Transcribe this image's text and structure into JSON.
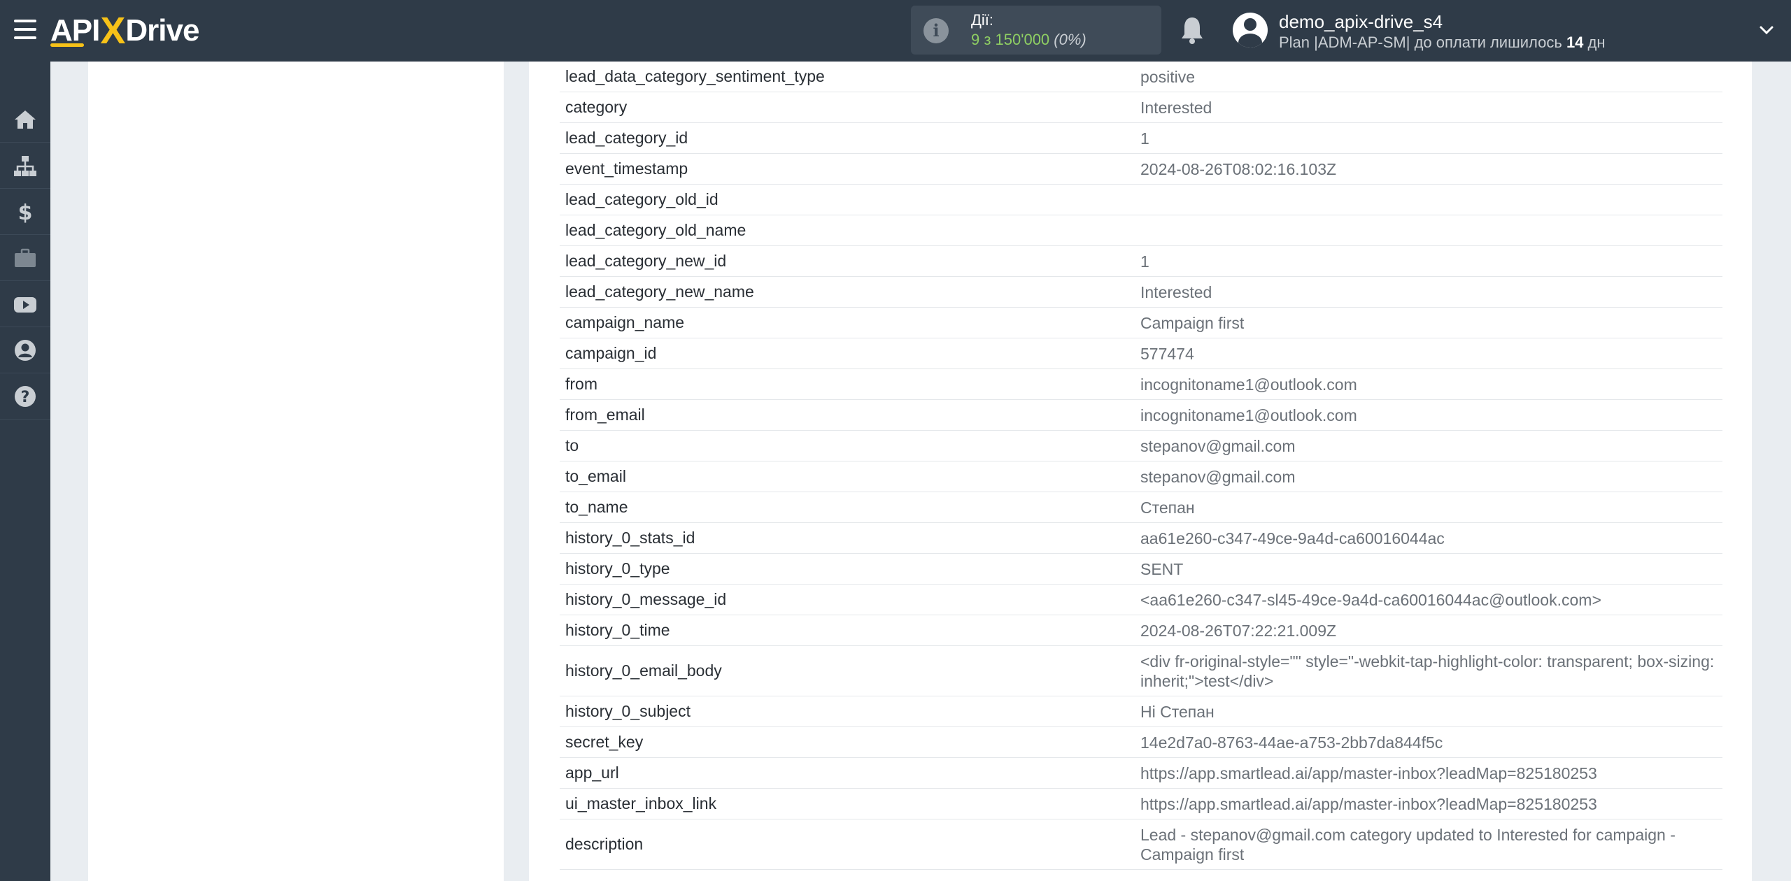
{
  "header": {
    "logo_left": "API",
    "logo_x": "X",
    "logo_right": "Drive",
    "actions_label": "Дії:",
    "actions_count": "9 з 150'000",
    "actions_pct": "(0%)",
    "user_name": "demo_apix-drive_s4",
    "plan_prefix": "Plan |ADM-AP-SM| до оплати лишилось ",
    "plan_days": "14",
    "plan_suffix": " дн"
  },
  "sidebar": {
    "items": [
      "home-icon",
      "sitemap-icon",
      "dollar-icon",
      "briefcase-icon",
      "youtube-icon",
      "user-circle-icon",
      "help-icon"
    ]
  },
  "table": {
    "rows": [
      {
        "key": "lead_data_category_sentiment_type",
        "value": "positive"
      },
      {
        "key": "category",
        "value": "Interested"
      },
      {
        "key": "lead_category_id",
        "value": "1"
      },
      {
        "key": "event_timestamp",
        "value": "2024-08-26T08:02:16.103Z"
      },
      {
        "key": "lead_category_old_id",
        "value": ""
      },
      {
        "key": "lead_category_old_name",
        "value": ""
      },
      {
        "key": "lead_category_new_id",
        "value": "1"
      },
      {
        "key": "lead_category_new_name",
        "value": "Interested"
      },
      {
        "key": "campaign_name",
        "value": "Campaign first"
      },
      {
        "key": "campaign_id",
        "value": "577474"
      },
      {
        "key": "from",
        "value": "incognitoname1@outlook.com"
      },
      {
        "key": "from_email",
        "value": "incognitoname1@outlook.com"
      },
      {
        "key": "to",
        "value": "stepanov@gmail.com"
      },
      {
        "key": "to_email",
        "value": "stepanov@gmail.com"
      },
      {
        "key": "to_name",
        "value": "Степан"
      },
      {
        "key": "history_0_stats_id",
        "value": "aa61e260-c347-49ce-9a4d-ca60016044ac"
      },
      {
        "key": "history_0_type",
        "value": "SENT"
      },
      {
        "key": "history_0_message_id",
        "value": "<aa61e260-c347-sl45-49ce-9a4d-ca60016044ac@outlook.com>"
      },
      {
        "key": "history_0_time",
        "value": "2024-08-26T07:22:21.009Z"
      },
      {
        "key": "history_0_email_body",
        "value": "<div fr-original-style=\"\" style=\"-webkit-tap-highlight-color: transparent; box-sizing: inherit;\">test</div>"
      },
      {
        "key": "history_0_subject",
        "value": "Hi Степан"
      },
      {
        "key": "secret_key",
        "value": "14e2d7a0-8763-44ae-a753-2bb7da844f5c"
      },
      {
        "key": "app_url",
        "value": "https://app.smartlead.ai/app/master-inbox?leadMap=825180253"
      },
      {
        "key": "ui_master_inbox_link",
        "value": "https://app.smartlead.ai/app/master-inbox?leadMap=825180253"
      },
      {
        "key": "description",
        "value": "Lead - stepanov@gmail.com category updated to Interested for campaign - Campaign first"
      }
    ]
  }
}
